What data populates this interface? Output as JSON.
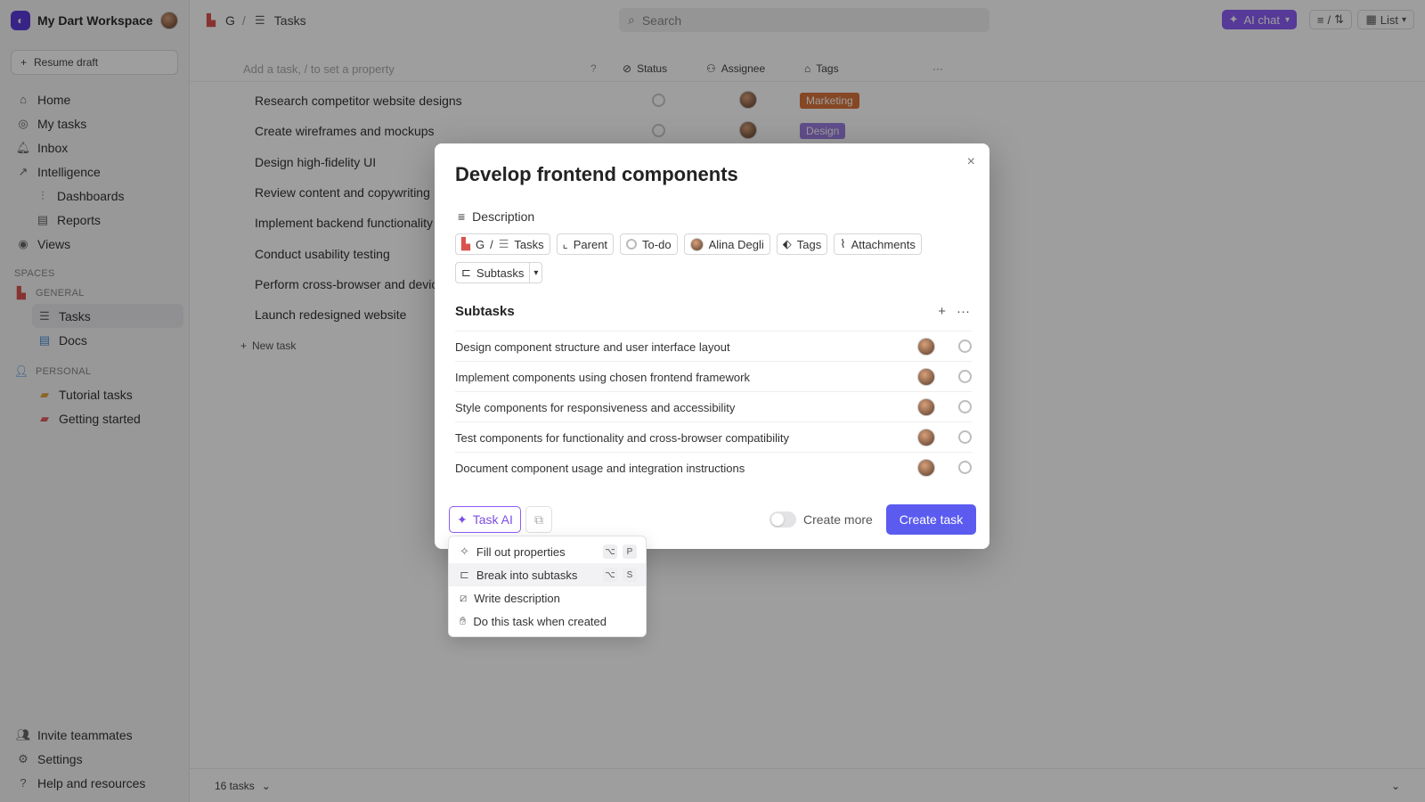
{
  "sidebar": {
    "workspace": "My Dart Workspace",
    "resume": "Resume draft",
    "nav": [
      {
        "label": "Home",
        "icon": "home-icon"
      },
      {
        "label": "My tasks",
        "icon": "target-icon"
      },
      {
        "label": "Inbox",
        "icon": "bell-icon"
      },
      {
        "label": "Intelligence",
        "icon": "chart-icon"
      }
    ],
    "intel_sub": [
      "Dashboards",
      "Reports"
    ],
    "views": "Views",
    "spaces_label": "SPACES",
    "general_label": "GENERAL",
    "general_items": [
      "Tasks",
      "Docs"
    ],
    "personal_label": "PERSONAL",
    "personal_items": [
      "Tutorial tasks",
      "Getting started"
    ],
    "bottom": [
      "Invite teammates",
      "Settings",
      "Help and resources"
    ]
  },
  "topbar": {
    "breadcrumb_space": "G",
    "breadcrumb_sep": "/",
    "breadcrumb_page": "Tasks",
    "search_placeholder": "Search",
    "ai_chat": "AI chat",
    "filter_label": "/",
    "list_label": "List"
  },
  "table": {
    "add_placeholder": "Add a task, / to set a property",
    "columns": {
      "status": "Status",
      "assignee": "Assignee",
      "tags": "Tags"
    },
    "rows": [
      {
        "title": "Research competitor website designs",
        "tag": "Marketing",
        "tag_color": "#d9733b"
      },
      {
        "title": "Create wireframes and mockups",
        "tag": "Design",
        "tag_color": "#9b7fe0"
      },
      {
        "title": "Design high-fidelity UI",
        "tag": "",
        "tag_color": ""
      },
      {
        "title": "Review content and copywriting",
        "tag": "",
        "tag_color": ""
      },
      {
        "title": "Implement backend functionality",
        "tag": "",
        "tag_color": ""
      },
      {
        "title": "Conduct usability testing",
        "tag": "",
        "tag_color": ""
      },
      {
        "title": "Perform cross-browser and device",
        "tag": "",
        "tag_color": ""
      },
      {
        "title": "Launch redesigned website",
        "tag": "",
        "tag_color": ""
      }
    ],
    "new_task": "New task",
    "count": "16 tasks"
  },
  "modal": {
    "title": "Develop frontend components",
    "description": "Description",
    "chips": {
      "space": "G",
      "sep": "/",
      "dartboard": "Tasks",
      "parent": "Parent",
      "status": "To-do",
      "assignee": "Alina Degli",
      "tags": "Tags",
      "attachments": "Attachments",
      "subtasks": "Subtasks"
    },
    "subtasks_title": "Subtasks",
    "subtasks": [
      "Design component structure and user interface layout",
      "Implement components using chosen frontend framework",
      "Style components for responsiveness and accessibility",
      "Test components for functionality and cross-browser compatibility",
      "Document component usage and integration instructions"
    ],
    "task_ai": "Task AI",
    "create_more": "Create more",
    "create_task": "Create task"
  },
  "menu": [
    {
      "label": "Fill out properties",
      "keys": [
        "⌥",
        "P"
      ]
    },
    {
      "label": "Break into subtasks",
      "keys": [
        "⌥",
        "S"
      ]
    },
    {
      "label": "Write description",
      "keys": []
    },
    {
      "label": "Do this task when created",
      "keys": []
    }
  ],
  "colors": {
    "accent": "#5b5bf0",
    "ai": "#8b5cf6"
  }
}
